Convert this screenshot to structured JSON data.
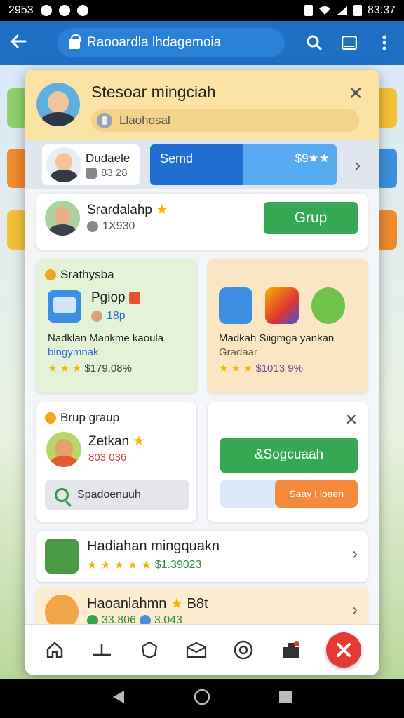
{
  "status_bar": {
    "time": "2953",
    "right_text": "83:37"
  },
  "app_bar": {
    "url": "Raooardla lhdagemoia"
  },
  "modal": {
    "title": "Stesoar mingciah",
    "search_placeholder": "Llaohosal",
    "strip": {
      "user_name": "Dudaele",
      "user_meta": "83.28",
      "progress_label": "Semd",
      "progress_amount": "$9★★",
      "progress_fraction": 0.5
    },
    "card_profile": {
      "name": "Srardalahp",
      "meta": "1X930",
      "button": "Grup"
    },
    "card_left": {
      "tag": "Srathysba",
      "title": "Pgiop",
      "meta": "18p",
      "desc1": "Nadklan Mankme kaoula",
      "desc2": "bingymnak",
      "stars_count": 3,
      "price": "$179.08%"
    },
    "card_right": {
      "desc1": "Madkah  Siigmga yankan",
      "desc2": "Gradaar",
      "stars_count": 3,
      "price": "$1013 9%"
    },
    "card_group": {
      "tag": "Brup graup",
      "name": "Zetkan",
      "meta": "803 036",
      "search_label": "Spadoenuuh"
    },
    "card_action": {
      "button": "&Sogcuaah",
      "slider_label": "Saay I loaen",
      "slider_fraction": 0.6
    },
    "row1": {
      "title": "Hadiahan mingquakn",
      "stars_count": 5,
      "price": "$1.39023"
    },
    "row2": {
      "title": "Haoanlahmn",
      "badge": "B8t",
      "meta1": "33.806",
      "meta2": "3.043"
    }
  },
  "colors": {
    "app_bar": "#1f6fc4",
    "header": "#fbe3a5",
    "accent_green": "#34a853",
    "accent_orange": "#f58a3c",
    "fab_red": "#e53935"
  },
  "tab_icons": [
    "home-icon",
    "analytics-icon",
    "shield-icon",
    "mail-icon",
    "globe-icon",
    "puzzle-icon"
  ]
}
